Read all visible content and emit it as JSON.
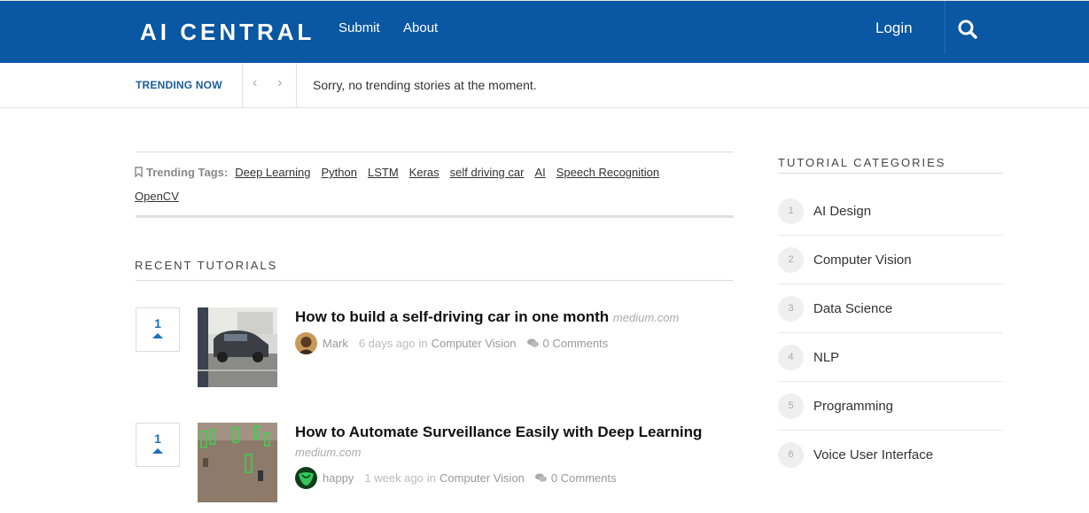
{
  "header": {
    "logo": "AI CENTRAL",
    "nav": {
      "submit": "Submit",
      "about": "About"
    },
    "login": "Login",
    "search_icon": "search-icon",
    "bg_color": "#0a57a3"
  },
  "trending": {
    "label": "TRENDING NOW",
    "prev": "‹",
    "next": "›",
    "message": "Sorry, no trending stories at the moment."
  },
  "tags": {
    "title": "Trending Tags:",
    "items": [
      "Deep Learning",
      "Python",
      "LSTM",
      "Keras",
      "self driving car",
      "AI",
      "Speech Recognition",
      "OpenCV"
    ]
  },
  "recent": {
    "title": "RECENT TUTORIALS",
    "posts": [
      {
        "votes": "1",
        "title": "How to build a self-driving car in one month",
        "source": "medium.com",
        "author": "Mark",
        "time": "6 days ago",
        "in_word": "in",
        "category": "Computer Vision",
        "comments": "0 Comments"
      },
      {
        "votes": "1",
        "title": "How to Automate Surveillance Easily with Deep Learning",
        "source": "medium.com",
        "author": "happy",
        "time": "1 week ago",
        "in_word": "in",
        "category": "Computer Vision",
        "comments": "0 Comments"
      }
    ]
  },
  "sidebar": {
    "title": "TUTORIAL CATEGORIES",
    "categories": [
      {
        "num": "1",
        "name": "AI Design"
      },
      {
        "num": "2",
        "name": "Computer Vision"
      },
      {
        "num": "3",
        "name": "Data Science"
      },
      {
        "num": "4",
        "name": "NLP"
      },
      {
        "num": "5",
        "name": "Programming"
      },
      {
        "num": "6",
        "name": "Voice User Interface"
      }
    ]
  },
  "colors": {
    "accent": "#1b6fbf",
    "label_blue": "#1b5e9e"
  }
}
